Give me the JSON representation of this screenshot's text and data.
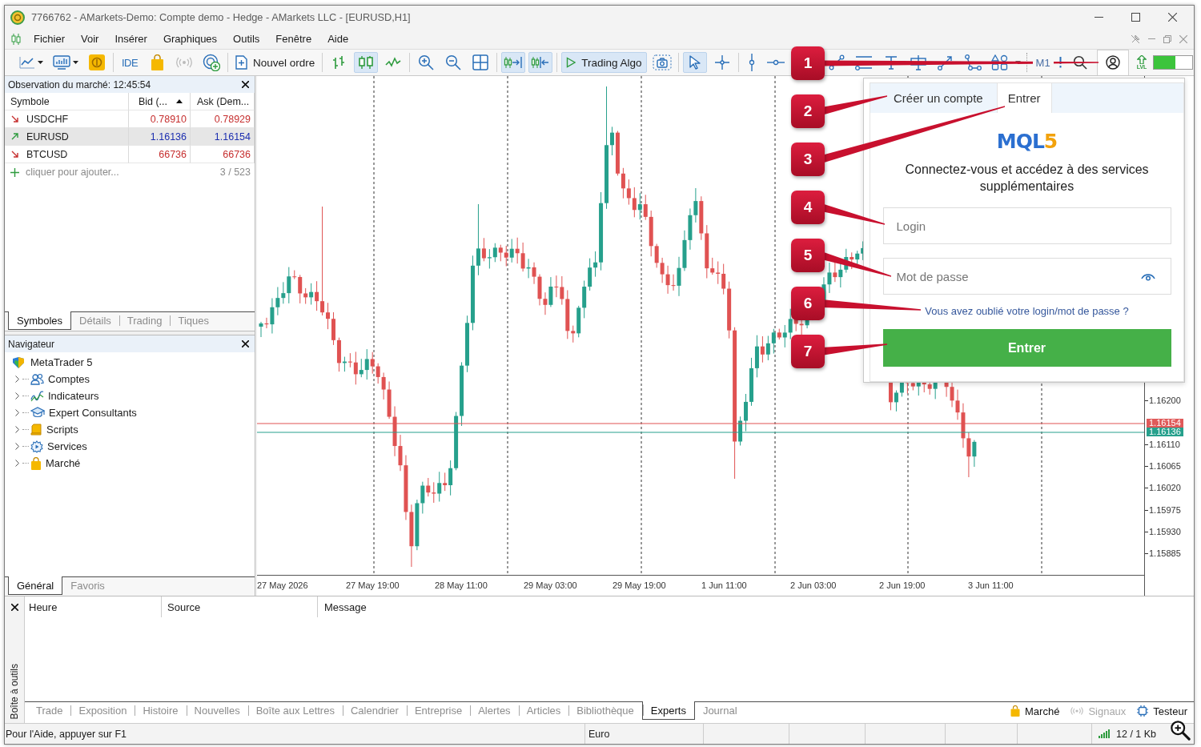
{
  "window": {
    "title": "7766762 - AMarkets-Demo: Compte demo - Hedge - AMarkets LLC - [EURUSD,H1]"
  },
  "menu": [
    "Fichier",
    "Voir",
    "Insérer",
    "Graphiques",
    "Outils",
    "Fenêtre",
    "Aide"
  ],
  "toolbar": {
    "ide_label": "IDE",
    "new_order_label": "Nouvel ordre",
    "candles_on": true,
    "autoscroll_on": true,
    "chart_shift_on": true,
    "algo_trading": {
      "label": "Trading Algo",
      "on": true
    },
    "cursor_on": true,
    "timeframe": "M1",
    "account_panel_on": true,
    "lvl_label": "LVL",
    "meter": {
      "level": 0.55
    }
  },
  "market_watch": {
    "title": "Observation du marché: 12:45:54",
    "columns": [
      {
        "label": "Symbole",
        "sorted": false
      },
      {
        "label": "Bid (...",
        "sorted": true
      },
      {
        "label": "Ask (Dem...",
        "sorted": false
      }
    ],
    "rows": [
      {
        "symbol": "USDCHF",
        "rising": false,
        "bid": "0.78910",
        "ask": "0.78929",
        "selected": false
      },
      {
        "symbol": "EURUSD",
        "rising": true,
        "bid": "1.16136",
        "ask": "1.16154",
        "selected": true
      },
      {
        "symbol": "BTCUSD",
        "rising": false,
        "bid": "66736",
        "ask": "66736",
        "selected": false
      }
    ],
    "add_hint": "cliquer pour ajouter...",
    "count": "3 / 523",
    "tabs": [
      {
        "label": "Symboles",
        "selected": true
      },
      {
        "label": "Détails",
        "selected": false
      },
      {
        "label": "Trading",
        "selected": false
      },
      {
        "label": "Tiques",
        "selected": false
      }
    ]
  },
  "navigator": {
    "title": "Navigateur",
    "tree": [
      {
        "label": "MetaTrader 5",
        "children": [
          {
            "label": "Comptes",
            "expanded": false
          },
          {
            "label": "Indicateurs",
            "expanded": false
          },
          {
            "label": "Expert Consultants",
            "expanded": false
          },
          {
            "label": "Scripts",
            "expanded": false
          },
          {
            "label": "Services",
            "expanded": false
          },
          {
            "label": "Marché",
            "expanded": false
          }
        ]
      }
    ],
    "tabs": [
      {
        "label": "Général",
        "selected": true
      },
      {
        "label": "Favoris",
        "selected": false
      }
    ]
  },
  "chart": {
    "time_labels": [
      "27 May 2026",
      "27 May 19:00",
      "28 May 11:00",
      "29 May 03:00",
      "29 May 19:00",
      "1 Jun 11:00",
      "2 Jun 03:00",
      "2 Jun 19:00",
      "3 Jun 11:00"
    ],
    "price_labels": [
      "1.16200",
      "1.16110",
      "1.16065",
      "1.16020",
      "1.15975",
      "1.15930",
      "1.15885"
    ],
    "ask_price": "1.16154",
    "bid_price": "1.16136"
  },
  "login_panel": {
    "tabs": [
      {
        "label": "Créer un compte",
        "selected": false
      },
      {
        "label": "Entrer",
        "selected": true
      }
    ],
    "logo": {
      "main": "MQL",
      "accent": "5"
    },
    "heading": "Connectez-vous et accédez à des services supplémentaires",
    "login_placeholder": "Login",
    "password_placeholder": "Mot de passe",
    "forgot_link": "Vous avez oublié votre login/mot de passe ?",
    "submit": "Entrer"
  },
  "toolbox": {
    "side_label": "Boîte à outils",
    "columns": [
      "Heure",
      "Source",
      "Message"
    ],
    "tabs": [
      {
        "label": "Trade",
        "selected": false
      },
      {
        "label": "Exposition",
        "selected": false
      },
      {
        "label": "Histoire",
        "selected": false
      },
      {
        "label": "Nouvelles",
        "selected": false
      },
      {
        "label": "Boîte aux Lettres",
        "selected": false
      },
      {
        "label": "Calendrier",
        "selected": false
      },
      {
        "label": "Entreprise",
        "selected": false
      },
      {
        "label": "Alertes",
        "selected": false
      },
      {
        "label": "Articles",
        "selected": false
      },
      {
        "label": "Bibliothèque",
        "selected": false
      },
      {
        "label": "Experts",
        "selected": true
      },
      {
        "label": "Journal",
        "selected": false
      }
    ],
    "shortcuts": [
      {
        "label": "Marché",
        "disabled": false
      },
      {
        "label": "Signaux",
        "disabled": true
      },
      {
        "label": "Testeur",
        "disabled": false
      }
    ]
  },
  "status_bar": {
    "help": "Pour l'Aide, appuyer sur F1",
    "profile": "Euro",
    "traffic": "12 / 1 Kb"
  },
  "callouts": [
    "1",
    "2",
    "3",
    "4",
    "5",
    "6",
    "7"
  ]
}
